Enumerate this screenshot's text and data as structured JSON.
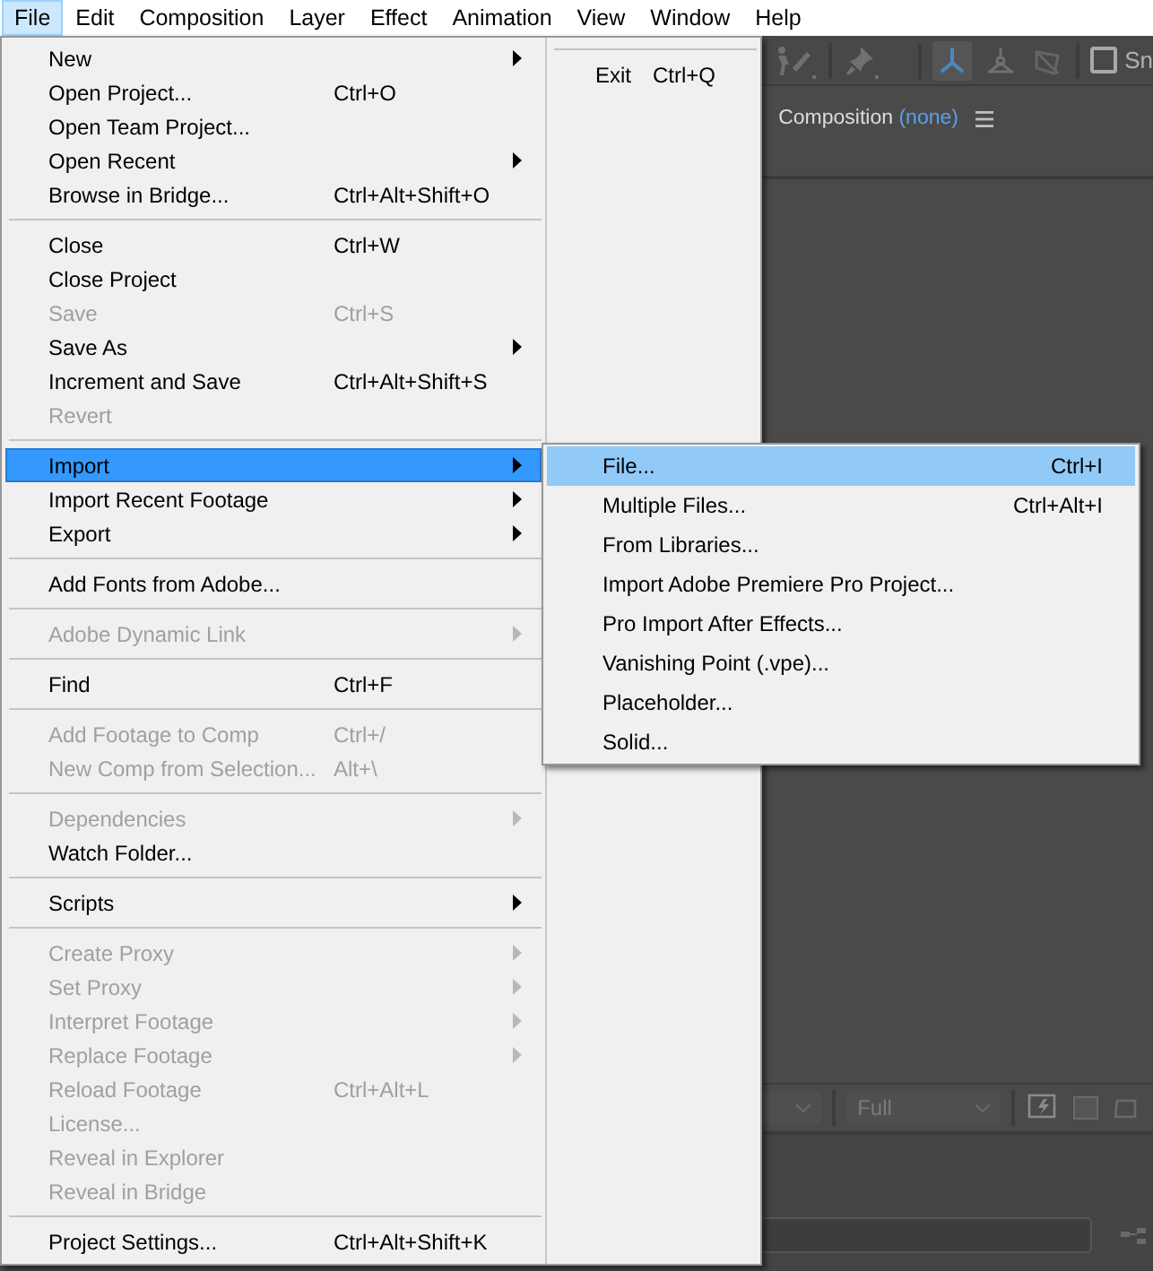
{
  "menubar": [
    {
      "label": "File",
      "selected": true
    },
    {
      "label": "Edit",
      "selected": false
    },
    {
      "label": "Composition",
      "selected": false
    },
    {
      "label": "Layer",
      "selected": false
    },
    {
      "label": "Effect",
      "selected": false
    },
    {
      "label": "Animation",
      "selected": false
    },
    {
      "label": "View",
      "selected": false
    },
    {
      "label": "Window",
      "selected": false
    },
    {
      "label": "Help",
      "selected": false
    }
  ],
  "file_menu": {
    "items": [
      {
        "kind": "item",
        "label": "New",
        "submenu": true,
        "disabled": false,
        "selected": false
      },
      {
        "kind": "item",
        "label": "Open Project...",
        "shortcut": "Ctrl+O",
        "submenu": false,
        "disabled": false,
        "selected": false
      },
      {
        "kind": "item",
        "label": "Open Team Project...",
        "submenu": false,
        "disabled": false,
        "selected": false
      },
      {
        "kind": "item",
        "label": "Open Recent",
        "submenu": true,
        "disabled": false,
        "selected": false
      },
      {
        "kind": "item",
        "label": "Browse in Bridge...",
        "shortcut": "Ctrl+Alt+Shift+O",
        "submenu": false,
        "disabled": false,
        "selected": false
      },
      {
        "kind": "separator"
      },
      {
        "kind": "item",
        "label": "Close",
        "shortcut": "Ctrl+W",
        "submenu": false,
        "disabled": false,
        "selected": false
      },
      {
        "kind": "item",
        "label": "Close Project",
        "submenu": false,
        "disabled": false,
        "selected": false
      },
      {
        "kind": "item",
        "label": "Save",
        "shortcut": "Ctrl+S",
        "submenu": false,
        "disabled": true,
        "selected": false
      },
      {
        "kind": "item",
        "label": "Save As",
        "submenu": true,
        "disabled": false,
        "selected": false
      },
      {
        "kind": "item",
        "label": "Increment and Save",
        "shortcut": "Ctrl+Alt+Shift+S",
        "submenu": false,
        "disabled": false,
        "selected": false
      },
      {
        "kind": "item",
        "label": "Revert",
        "submenu": false,
        "disabled": true,
        "selected": false
      },
      {
        "kind": "separator"
      },
      {
        "kind": "item",
        "label": "Import",
        "submenu": true,
        "disabled": false,
        "selected": true
      },
      {
        "kind": "item",
        "label": "Import Recent Footage",
        "submenu": true,
        "disabled": false,
        "selected": false
      },
      {
        "kind": "item",
        "label": "Export",
        "submenu": true,
        "disabled": false,
        "selected": false
      },
      {
        "kind": "separator"
      },
      {
        "kind": "item",
        "label": "Add Fonts from Adobe...",
        "submenu": false,
        "disabled": false,
        "selected": false
      },
      {
        "kind": "separator"
      },
      {
        "kind": "item",
        "label": "Adobe Dynamic Link",
        "submenu": true,
        "disabled": true,
        "selected": false
      },
      {
        "kind": "separator"
      },
      {
        "kind": "item",
        "label": "Find",
        "shortcut": "Ctrl+F",
        "submenu": false,
        "disabled": false,
        "selected": false
      },
      {
        "kind": "separator"
      },
      {
        "kind": "item",
        "label": "Add Footage to Comp",
        "shortcut": "Ctrl+/",
        "submenu": false,
        "disabled": true,
        "selected": false
      },
      {
        "kind": "item",
        "label": "New Comp from Selection...",
        "shortcut": "Alt+\\",
        "submenu": false,
        "disabled": true,
        "selected": false
      },
      {
        "kind": "separator"
      },
      {
        "kind": "item",
        "label": "Dependencies",
        "submenu": true,
        "disabled": true,
        "selected": false
      },
      {
        "kind": "item",
        "label": "Watch Folder...",
        "submenu": false,
        "disabled": false,
        "selected": false
      },
      {
        "kind": "separator"
      },
      {
        "kind": "item",
        "label": "Scripts",
        "submenu": true,
        "disabled": false,
        "selected": false
      },
      {
        "kind": "separator"
      },
      {
        "kind": "item",
        "label": "Create Proxy",
        "submenu": true,
        "disabled": true,
        "selected": false
      },
      {
        "kind": "item",
        "label": "Set Proxy",
        "submenu": true,
        "disabled": true,
        "selected": false
      },
      {
        "kind": "item",
        "label": "Interpret Footage",
        "submenu": true,
        "disabled": true,
        "selected": false
      },
      {
        "kind": "item",
        "label": "Replace Footage",
        "submenu": true,
        "disabled": true,
        "selected": false
      },
      {
        "kind": "item",
        "label": "Reload Footage",
        "shortcut": "Ctrl+Alt+L",
        "submenu": false,
        "disabled": true,
        "selected": false
      },
      {
        "kind": "item",
        "label": "License...",
        "submenu": false,
        "disabled": true,
        "selected": false
      },
      {
        "kind": "item",
        "label": "Reveal in Explorer",
        "submenu": false,
        "disabled": true,
        "selected": false
      },
      {
        "kind": "item",
        "label": "Reveal in Bridge",
        "submenu": false,
        "disabled": true,
        "selected": false
      },
      {
        "kind": "separator"
      },
      {
        "kind": "item",
        "label": "Project Settings...",
        "shortcut": "Ctrl+Alt+Shift+K",
        "submenu": false,
        "disabled": false,
        "selected": false
      }
    ],
    "column_2": [
      {
        "kind": "separator"
      },
      {
        "kind": "item",
        "label": "Exit",
        "shortcut": "Ctrl+Q",
        "submenu": false,
        "disabled": false,
        "selected": false
      }
    ]
  },
  "import_submenu": {
    "items": [
      {
        "label": "File...",
        "shortcut": "Ctrl+I",
        "selected": true
      },
      {
        "label": "Multiple Files...",
        "shortcut": "Ctrl+Alt+I",
        "selected": false
      },
      {
        "label": "From Libraries...",
        "selected": false
      },
      {
        "label": "Import Adobe Premiere Pro Project...",
        "selected": false
      },
      {
        "label": "Pro Import After Effects...",
        "selected": false
      },
      {
        "label": "Vanishing Point (.vpe)...",
        "selected": false
      },
      {
        "label": "Placeholder...",
        "selected": false
      },
      {
        "label": "Solid...",
        "selected": false
      }
    ]
  },
  "toolbar": {
    "checkbox": {
      "label": "Sn",
      "checked": false
    }
  },
  "composition_panel": {
    "title": "Composition",
    "subtitle": "(none)"
  },
  "viewer_controls": {
    "resolution": "Full"
  }
}
